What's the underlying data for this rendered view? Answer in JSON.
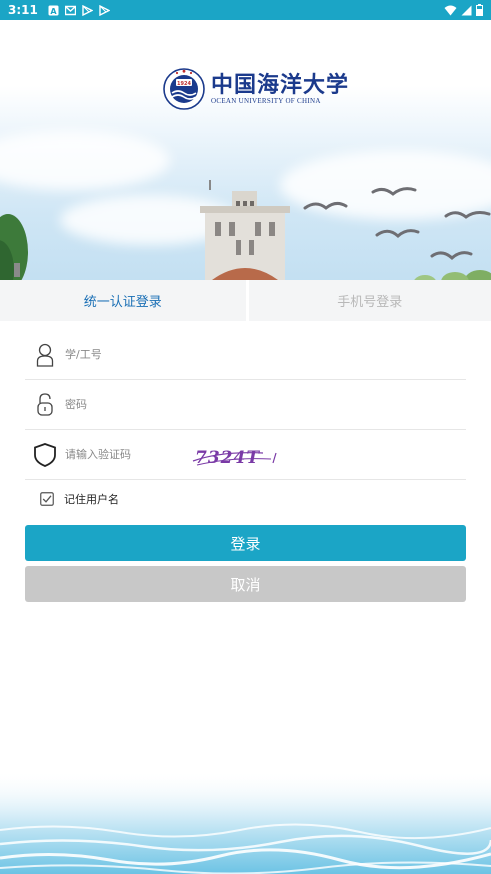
{
  "status_bar": {
    "time": "3:11",
    "notification_icons": [
      "a-icon",
      "mail-icon",
      "play-icon",
      "play-icon"
    ],
    "right_icons": [
      "wifi-icon",
      "signal-icon",
      "battery-icon"
    ]
  },
  "header": {
    "logo_cn": "中国海洋大学",
    "logo_en": "OCEAN UNIVERSITY OF CHINA",
    "seal_year": "1924"
  },
  "tabs": [
    {
      "label": "统一认证登录",
      "active": true
    },
    {
      "label": "手机号登录",
      "active": false
    }
  ],
  "form": {
    "username_placeholder": "学/工号",
    "password_placeholder": "密码",
    "captcha_placeholder": "请输入验证码",
    "captcha_text": "7324T"
  },
  "remember": {
    "label": "记住用户名",
    "checked": true
  },
  "buttons": {
    "login": "登录",
    "cancel": "取消"
  },
  "colors": {
    "primary": "#1ba5c6",
    "tab_active": "#1a6fb5",
    "cancel": "#c8c8c8",
    "logo": "#1b3a8c"
  }
}
